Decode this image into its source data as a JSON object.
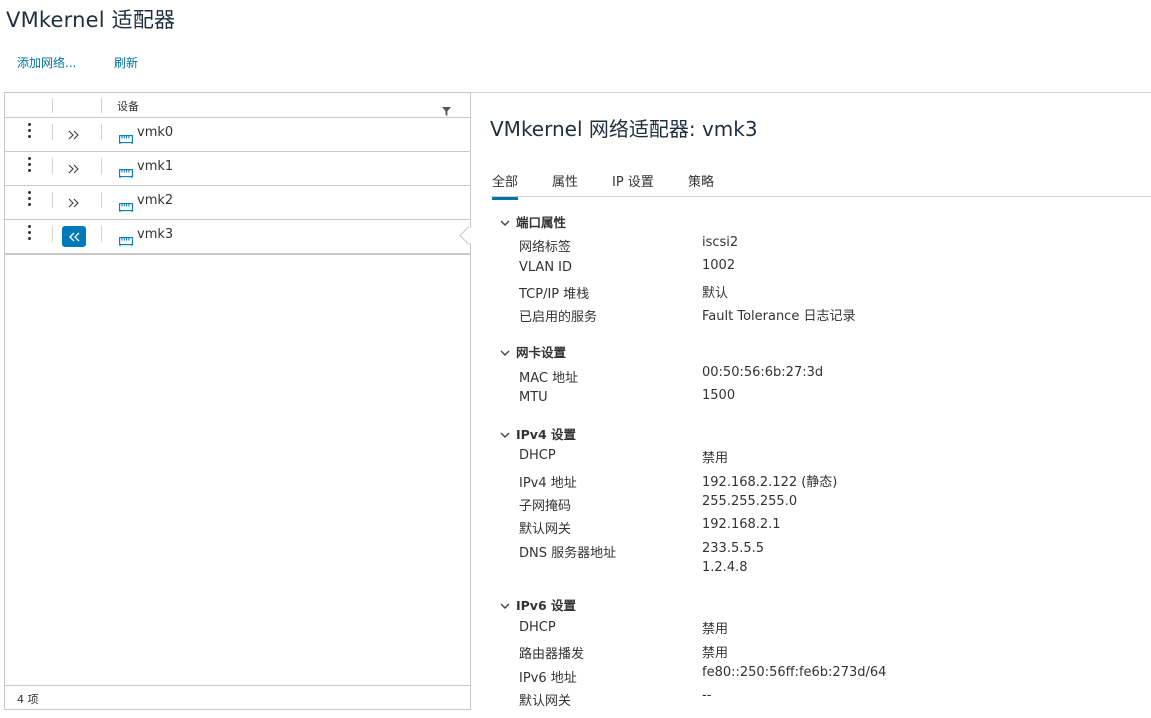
{
  "page_title": "VMkernel 适配器",
  "actions": {
    "add_network": "添加网络...",
    "refresh": "刷新"
  },
  "grid": {
    "column_header": "设备",
    "rows": [
      {
        "label": "vmk0",
        "expanded": false
      },
      {
        "label": "vmk1",
        "expanded": false
      },
      {
        "label": "vmk2",
        "expanded": false
      },
      {
        "label": "vmk3",
        "expanded": true
      }
    ],
    "footer": "4 项"
  },
  "detail": {
    "title": "VMkernel 网络适配器: vmk3",
    "tabs": [
      "全部",
      "属性",
      "IP 设置",
      "策略"
    ],
    "active_tab": "全部",
    "sections": {
      "port": {
        "title": "端口属性",
        "network_label": {
          "label": "网络标签",
          "value": "iscsi2"
        },
        "vlan": {
          "label": "VLAN ID",
          "value": "1002"
        },
        "tcpip": {
          "label": "TCP/IP 堆栈",
          "value": "默认"
        },
        "services": {
          "label": "已启用的服务",
          "value": "Fault Tolerance 日志记录"
        }
      },
      "nic": {
        "title": "网卡设置",
        "mac": {
          "label": "MAC 地址",
          "value": "00:50:56:6b:27:3d"
        },
        "mtu": {
          "label": "MTU",
          "value": "1500"
        }
      },
      "ipv4": {
        "title": "IPv4 设置",
        "dhcp": {
          "label": "DHCP",
          "value": "禁用"
        },
        "address": {
          "label": "IPv4 地址",
          "value": "192.168.2.122 (静态)"
        },
        "subnet": {
          "label": "子网掩码",
          "value": "255.255.255.0"
        },
        "gateway": {
          "label": "默认网关",
          "value": "192.168.2.1"
        },
        "dns": {
          "label": "DNS 服务器地址",
          "values": [
            "233.5.5.5",
            "1.2.4.8"
          ]
        }
      },
      "ipv6": {
        "title": "IPv6 设置",
        "dhcp": {
          "label": "DHCP",
          "value": "禁用"
        },
        "router_adv": {
          "label": "路由器播发",
          "value": "禁用"
        },
        "address": {
          "label": "IPv6 地址",
          "value": "fe80::250:56ff:fe6b:273d/64"
        },
        "gateway": {
          "label": "默认网关",
          "value": "--"
        }
      }
    }
  },
  "colors": {
    "accent": "#0072a3",
    "active_button": "#0079b8",
    "border": "#c8c8c8"
  }
}
